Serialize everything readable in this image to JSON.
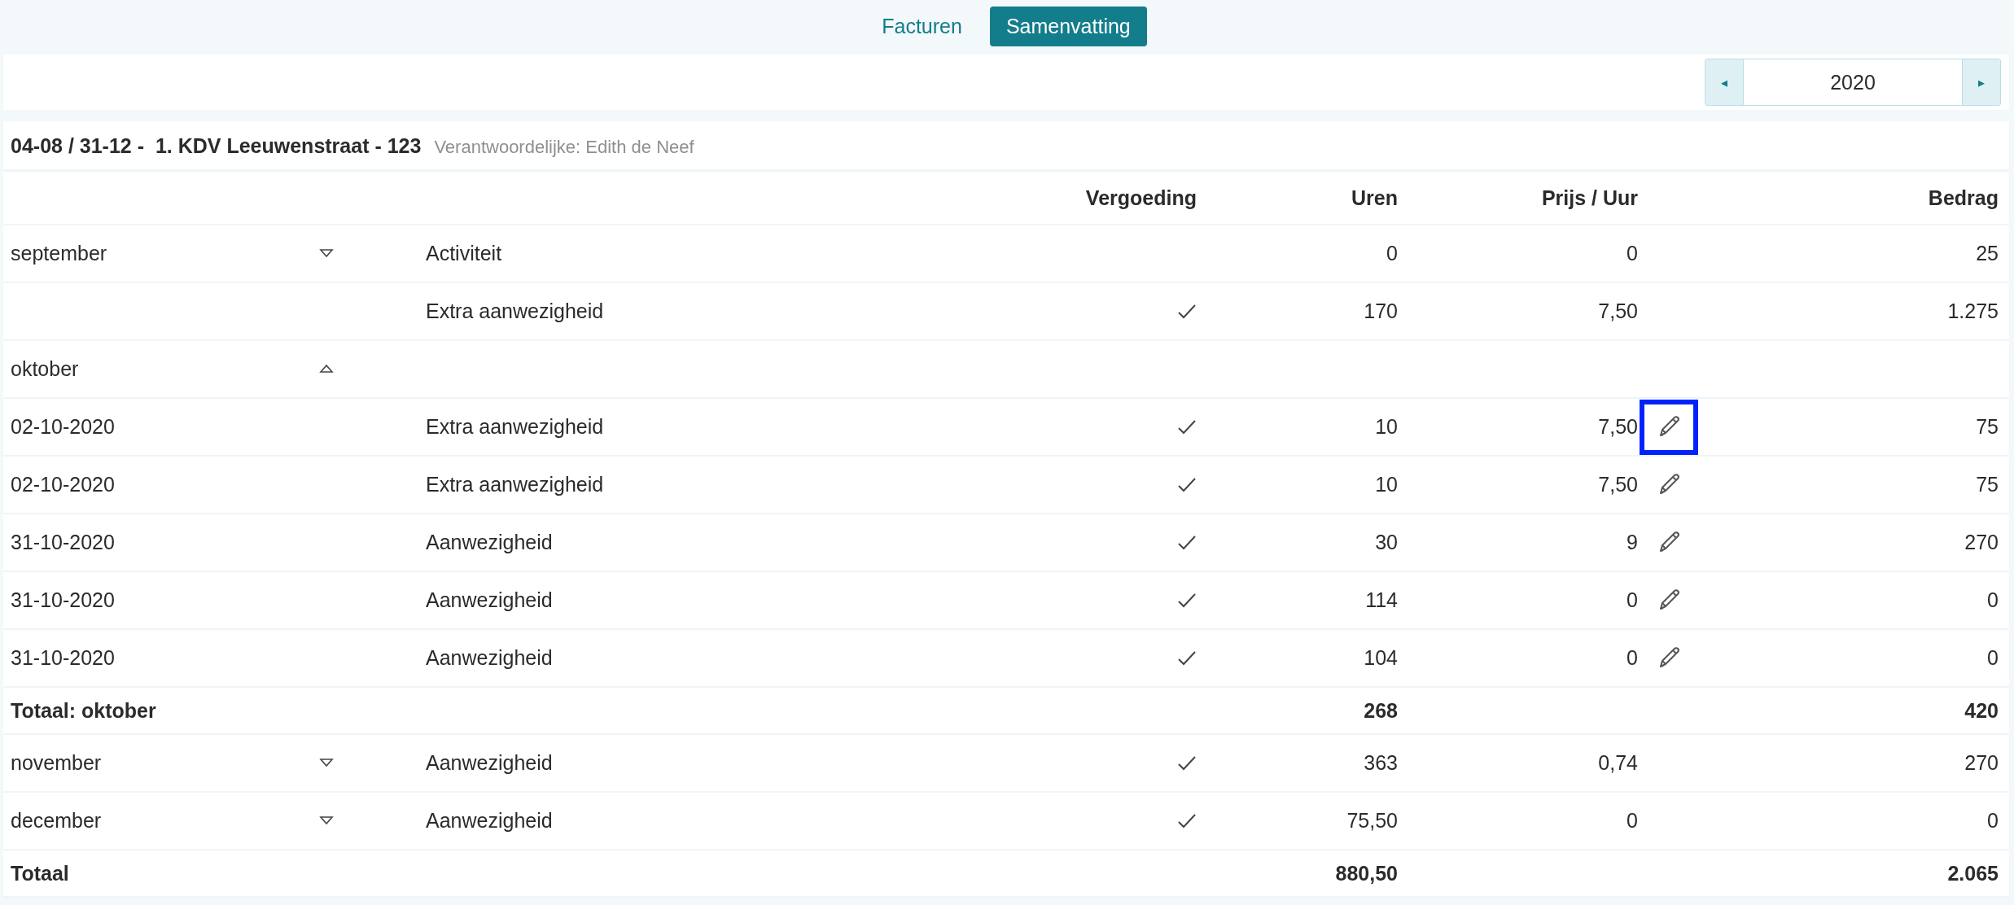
{
  "tabs": [
    {
      "label": "Facturen",
      "selected": false
    },
    {
      "label": "Samenvatting",
      "selected": true
    }
  ],
  "year_picker": {
    "prev": "◂",
    "value": "2020",
    "next": "▸"
  },
  "section": {
    "title": "04-08 / 31-12 -  1. KDV Leeuwenstraat - 123",
    "responsible": "Verantwoordelijke: Edith de Neef"
  },
  "columns": [
    "Vergoeding",
    "Uren",
    "Prijs / Uur",
    "Bedrag"
  ],
  "rows": [
    {
      "kind": "line",
      "label": "september",
      "expanded": false,
      "description": "Activiteit",
      "vergoeding": false,
      "uren": "0",
      "prijs": "0",
      "editable": false,
      "bedrag": "25"
    },
    {
      "kind": "line",
      "description": "Extra aanwezigheid",
      "vergoeding": true,
      "uren": "170",
      "prijs": "7,50",
      "editable": false,
      "bedrag": "1.275"
    },
    {
      "kind": "line",
      "label": "oktober",
      "expanded": true,
      "vergoeding": false,
      "editable": false
    },
    {
      "kind": "line",
      "label": "02-10-2020",
      "description": "Extra aanwezigheid",
      "vergoeding": true,
      "uren": "10",
      "prijs": "7,50",
      "editable": true,
      "highlighted": true,
      "bedrag": "75"
    },
    {
      "kind": "line",
      "label": "02-10-2020",
      "description": "Extra aanwezigheid",
      "vergoeding": true,
      "uren": "10",
      "prijs": "7,50",
      "editable": true,
      "highlighted": false,
      "bedrag": "75"
    },
    {
      "kind": "line",
      "label": "31-10-2020",
      "description": "Aanwezigheid",
      "vergoeding": true,
      "uren": "30",
      "prijs": "9",
      "editable": true,
      "highlighted": false,
      "bedrag": "270"
    },
    {
      "kind": "line",
      "label": "31-10-2020",
      "description": "Aanwezigheid",
      "vergoeding": true,
      "uren": "114",
      "prijs": "0",
      "editable": true,
      "highlighted": false,
      "bedrag": "0"
    },
    {
      "kind": "line",
      "label": "31-10-2020",
      "description": "Aanwezigheid",
      "vergoeding": true,
      "uren": "104",
      "prijs": "0",
      "editable": true,
      "highlighted": false,
      "bedrag": "0"
    },
    {
      "kind": "total",
      "label": "Totaal: oktober",
      "uren": "268",
      "bedrag": "420"
    },
    {
      "kind": "line",
      "label": "november",
      "expanded": false,
      "description": "Aanwezigheid",
      "vergoeding": true,
      "uren": "363",
      "prijs": "0,74",
      "editable": false,
      "bedrag": "270"
    },
    {
      "kind": "line",
      "label": "december",
      "expanded": false,
      "description": "Aanwezigheid",
      "vergoeding": true,
      "uren": "75,50",
      "prijs": "0",
      "editable": false,
      "bedrag": "0"
    },
    {
      "kind": "total",
      "label": "Totaal",
      "uren": "880,50",
      "bedrag": "2.065"
    }
  ]
}
